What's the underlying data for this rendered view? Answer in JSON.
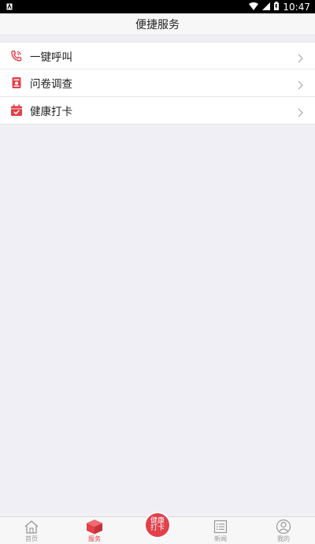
{
  "status_bar": {
    "time": "10:47",
    "icons": [
      "notification-icon",
      "wifi-icon",
      "signal-icon",
      "battery-icon"
    ]
  },
  "header": {
    "title": "便捷服务"
  },
  "services": {
    "items": [
      {
        "label": "一键呼叫",
        "icon": "phone-call-icon"
      },
      {
        "label": "问卷调查",
        "icon": "clipboard-icon"
      },
      {
        "label": "健康打卡",
        "icon": "calendar-check-icon"
      }
    ]
  },
  "tabs": {
    "items": [
      {
        "label": "首页",
        "icon": "home-icon"
      },
      {
        "label": "服务",
        "icon": "cube-icon",
        "active": true
      },
      {
        "label": "健康打卡",
        "icon": "health-checkin-badge"
      },
      {
        "label": "新闻",
        "icon": "news-list-icon"
      },
      {
        "label": "我的",
        "icon": "user-icon"
      }
    ]
  },
  "colors": {
    "accent": "#e2404a",
    "background": "#f0eff5",
    "status_bar": "#000000"
  }
}
